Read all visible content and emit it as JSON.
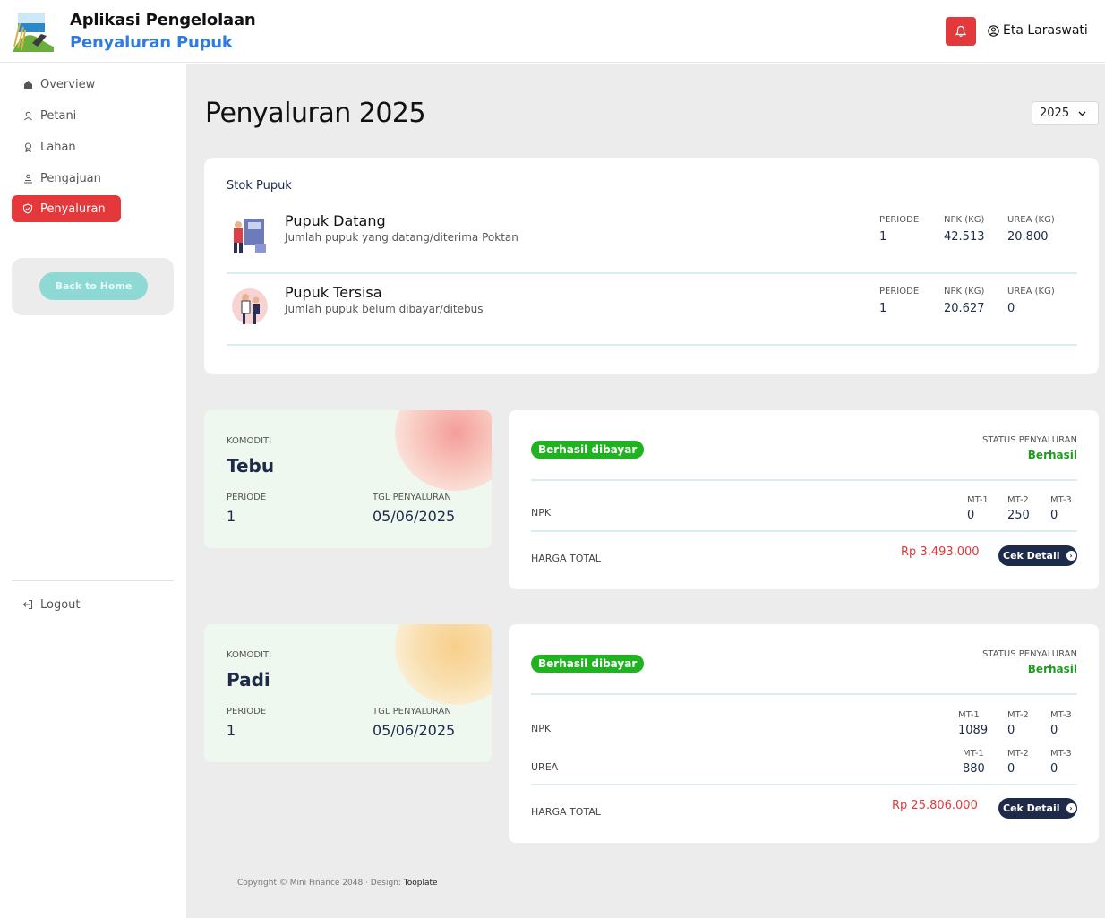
{
  "header": {
    "app_title": "Aplikasi Pengelolaan",
    "app_subtitle": "Penyaluran Pupuk",
    "user_name": "Eta Laraswati"
  },
  "sidebar": {
    "items": [
      {
        "label": "Overview",
        "icon": "home-icon"
      },
      {
        "label": "Petani",
        "icon": "user-icon"
      },
      {
        "label": "Lahan",
        "icon": "map-pin-icon"
      },
      {
        "label": "Pengajuan",
        "icon": "form-icon"
      },
      {
        "label": "Penyaluran",
        "icon": "shield-icon",
        "active": true
      }
    ],
    "back_label": "Back to Home",
    "logout_label": "Logout"
  },
  "main": {
    "title": "Penyaluran 2025",
    "year_selected": "2025"
  },
  "stok": {
    "heading": "Stok Pupuk",
    "rows": [
      {
        "name": "Pupuk Datang",
        "desc": "Jumlah pupuk yang datang/diterima Poktan",
        "periode_label": "PERIODE",
        "periode": "1",
        "npk_label": "NPK (KG)",
        "npk": "42.513",
        "urea_label": "UREA (KG)",
        "urea": "20.800"
      },
      {
        "name": "Pupuk Tersisa",
        "desc": "Jumlah pupuk belum dibayar/ditebus",
        "periode_label": "PERIODE",
        "periode": "1",
        "npk_label": "NPK (KG)",
        "npk": "20.627",
        "urea_label": "UREA (KG)",
        "urea": "0"
      }
    ]
  },
  "penyaluran": [
    {
      "komoditi_label": "KOMODITI",
      "komoditi": "Tebu",
      "periode_label": "PERIODE",
      "periode": "1",
      "tgl_label": "TGL PENYALURAN",
      "tgl": "05/06/2025",
      "badge": "Berhasil dibayar",
      "status_label": "STATUS PENYALURAN",
      "status": "Berhasil",
      "npk_label": "NPK",
      "npk": [
        {
          "mt": "MT-1",
          "v": "0"
        },
        {
          "mt": "MT-2",
          "v": "250"
        },
        {
          "mt": "MT-3",
          "v": "0"
        }
      ],
      "harga_label": "HARGA TOTAL",
      "harga": "Rp 3.493.000",
      "detail_label": "Cek Detail"
    },
    {
      "komoditi_label": "KOMODITI",
      "komoditi": "Padi",
      "periode_label": "PERIODE",
      "periode": "1",
      "tgl_label": "TGL PENYALURAN",
      "tgl": "05/06/2025",
      "badge": "Berhasil dibayar",
      "status_label": "STATUS PENYALURAN",
      "status": "Berhasil",
      "npk_label": "NPK",
      "npk": [
        {
          "mt": "MT-1",
          "v": "1089"
        },
        {
          "mt": "MT-2",
          "v": "0"
        },
        {
          "mt": "MT-3",
          "v": "0"
        }
      ],
      "urea_label": "UREA",
      "urea": [
        {
          "mt": "MT-1",
          "v": "880"
        },
        {
          "mt": "MT-2",
          "v": "0"
        },
        {
          "mt": "MT-3",
          "v": "0"
        }
      ],
      "harga_label": "HARGA TOTAL",
      "harga": "Rp 25.806.000",
      "detail_label": "Cek Detail"
    }
  ],
  "footer": {
    "text": "Copyright © Mini Finance 2048 · Design: ",
    "link": "Tooplate"
  },
  "colors": {
    "accent_red": "#e4383b",
    "brand_blue": "#2f7be0",
    "success_green": "#1fb31f",
    "navy": "#1e2a4a",
    "teal_button": "#8fd9d4"
  }
}
